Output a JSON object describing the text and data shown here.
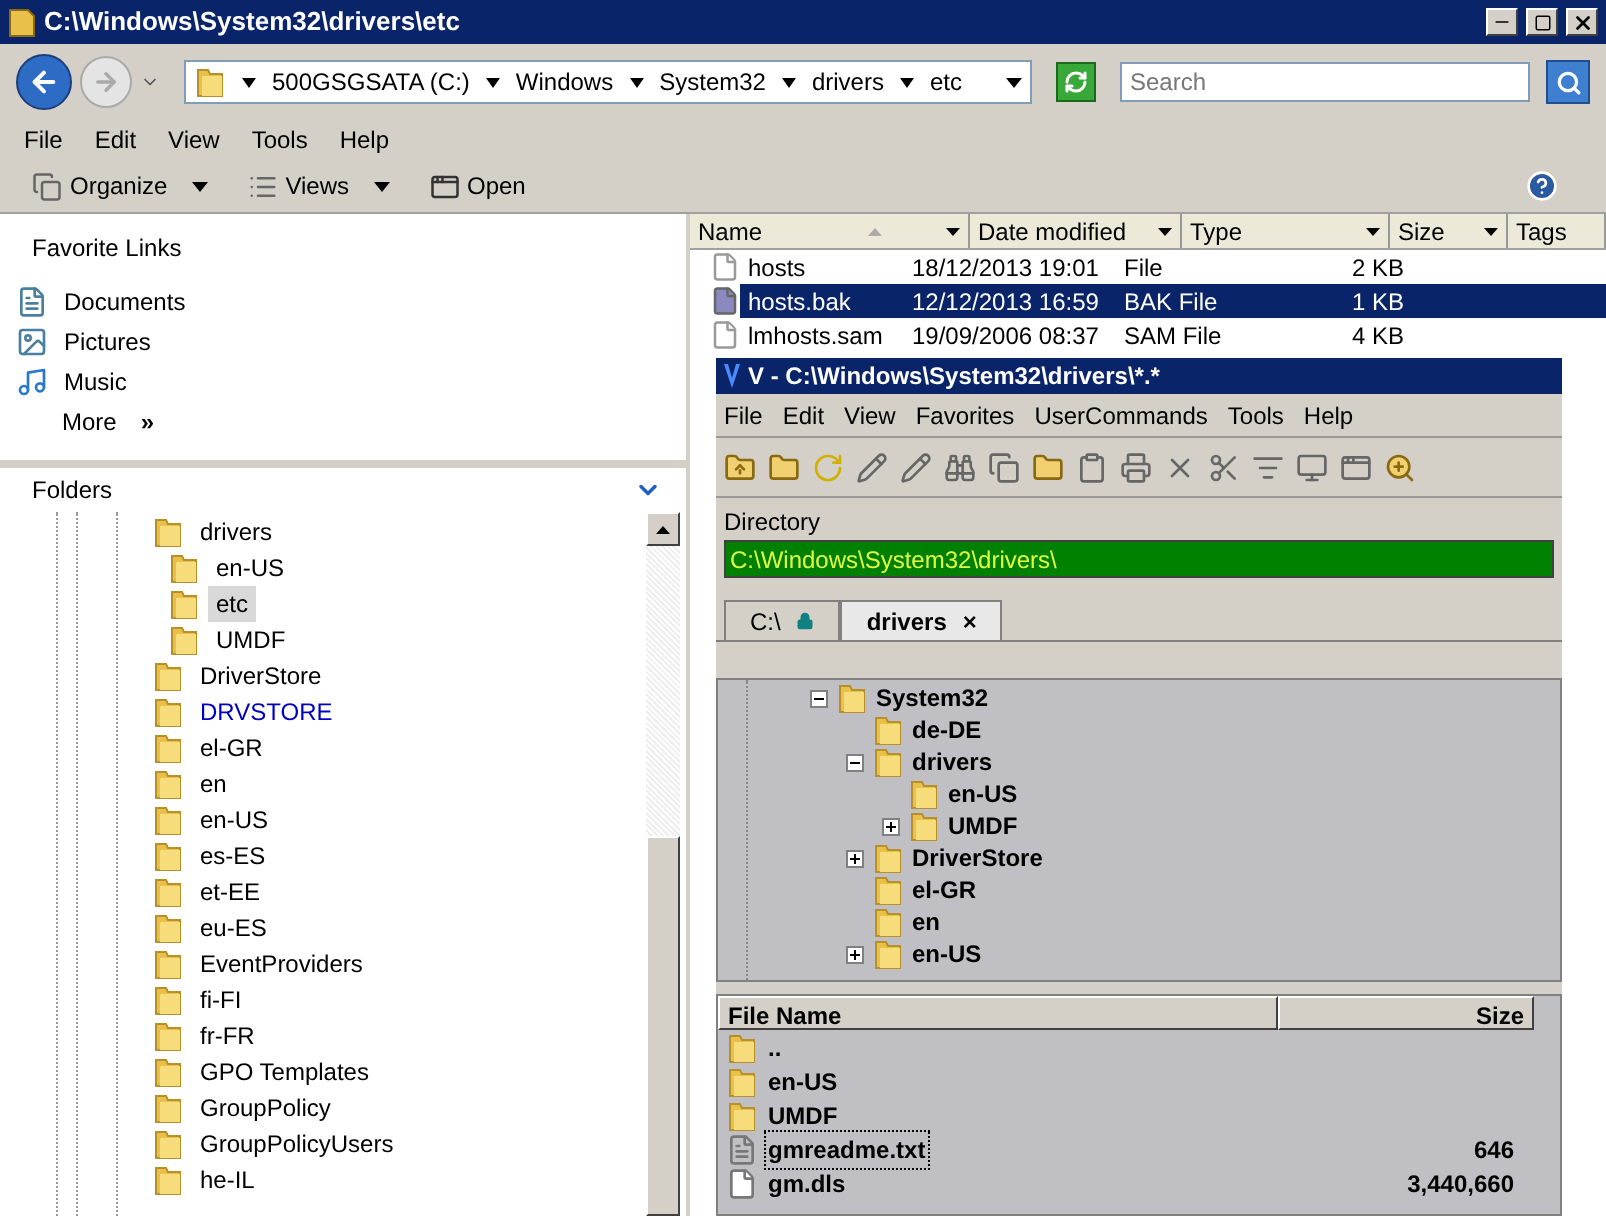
{
  "window": {
    "title": "C:\\Windows\\System32\\drivers\\etc"
  },
  "address_bar": {
    "crumbs": [
      "500GSGSATA (C:)",
      "Windows",
      "System32",
      "drivers",
      "etc"
    ]
  },
  "search": {
    "placeholder": "Search"
  },
  "menu": [
    "File",
    "Edit",
    "View",
    "Tools",
    "Help"
  ],
  "toolbar": [
    {
      "kind": "organize",
      "label": "Organize",
      "dropdown": true
    },
    {
      "kind": "views",
      "label": "Views",
      "dropdown": true
    },
    {
      "kind": "open",
      "label": "Open",
      "dropdown": false
    }
  ],
  "favorite_links": {
    "title": "Favorite Links",
    "items": [
      {
        "kind": "documents",
        "label": "Documents"
      },
      {
        "kind": "pictures",
        "label": "Pictures"
      },
      {
        "kind": "music",
        "label": "Music"
      }
    ],
    "more": "More",
    "more_glyph": "»"
  },
  "folders": {
    "title": "Folders",
    "items": [
      {
        "label": "drivers",
        "selected": false,
        "compressed": false,
        "children": [
          {
            "label": "en-US",
            "selected": false,
            "compressed": false
          },
          {
            "label": "etc",
            "selected": true,
            "compressed": false
          },
          {
            "label": "UMDF",
            "selected": false,
            "compressed": false
          }
        ]
      },
      {
        "label": "DriverStore",
        "selected": false,
        "compressed": false
      },
      {
        "label": "DRVSTORE",
        "selected": false,
        "compressed": true
      },
      {
        "label": "el-GR",
        "selected": false,
        "compressed": false
      },
      {
        "label": "en",
        "selected": false,
        "compressed": false
      },
      {
        "label": "en-US",
        "selected": false,
        "compressed": false
      },
      {
        "label": "es-ES",
        "selected": false,
        "compressed": false
      },
      {
        "label": "et-EE",
        "selected": false,
        "compressed": false
      },
      {
        "label": "eu-ES",
        "selected": false,
        "compressed": false
      },
      {
        "label": "EventProviders",
        "selected": false,
        "compressed": false
      },
      {
        "label": "fi-FI",
        "selected": false,
        "compressed": false
      },
      {
        "label": "fr-FR",
        "selected": false,
        "compressed": false
      },
      {
        "label": "GPO Templates",
        "selected": false,
        "compressed": false
      },
      {
        "label": "GroupPolicy",
        "selected": false,
        "compressed": false
      },
      {
        "label": "GroupPolicyUsers",
        "selected": false,
        "compressed": false
      },
      {
        "label": "he-IL",
        "selected": false,
        "compressed": false
      }
    ]
  },
  "file_list": {
    "columns": [
      {
        "label": "Name",
        "sorted": true
      },
      {
        "label": "Date modified",
        "sorted": false
      },
      {
        "label": "Type",
        "sorted": false
      },
      {
        "label": "Size",
        "sorted": false
      },
      {
        "label": "Tags",
        "sorted": false
      }
    ],
    "rows": [
      {
        "name": "hosts",
        "date": "18/12/2013 19:01",
        "type": "File",
        "size": "2 KB",
        "selected": false
      },
      {
        "name": "hosts.bak",
        "date": "12/12/2013 16:59",
        "type": "BAK File",
        "size": "1 KB",
        "selected": true
      },
      {
        "name": "lmhosts.sam",
        "date": "19/09/2006 08:37",
        "type": "SAM File",
        "size": "4 KB",
        "selected": false
      }
    ]
  },
  "second_window": {
    "title": "V - C:\\Windows\\System32\\drivers\\*.*",
    "menu": [
      "File",
      "Edit",
      "View",
      "Favorites",
      "UserCommands",
      "Tools",
      "Help"
    ],
    "directory_label": "Directory",
    "directory": "C:\\Windows\\System32\\drivers\\",
    "tabs": [
      {
        "label": "C:\\",
        "locked": true,
        "closable": false,
        "selected": false
      },
      {
        "label": "drivers",
        "locked": false,
        "closable": true,
        "selected": true
      }
    ],
    "tab_close": "×",
    "tree": [
      {
        "label": "System32",
        "expandable": true,
        "expanded": true,
        "children": [
          {
            "label": "de-DE",
            "expandable": false
          },
          {
            "label": "drivers",
            "expandable": true,
            "expanded": true,
            "children": [
              {
                "label": "en-US",
                "expandable": false
              },
              {
                "label": "UMDF",
                "expandable": true,
                "expanded": false
              }
            ]
          },
          {
            "label": "DriverStore",
            "expandable": true,
            "expanded": false
          },
          {
            "label": "el-GR",
            "expandable": false
          },
          {
            "label": "en",
            "expandable": false
          },
          {
            "label": "en-US",
            "expandable": true,
            "expanded": false
          }
        ]
      }
    ],
    "columns": [
      "File Name",
      "Size"
    ],
    "files": [
      {
        "kind": "folder",
        "name": "..",
        "focused": false
      },
      {
        "kind": "folder",
        "name": "en-US",
        "focused": false
      },
      {
        "kind": "folder",
        "name": "UMDF",
        "focused": false
      },
      {
        "kind": "text",
        "name": "gmreadme.txt",
        "size": "646",
        "focused": true
      },
      {
        "kind": "file",
        "name": "gm.dls",
        "size": "3,440,660",
        "focused": false
      }
    ]
  }
}
